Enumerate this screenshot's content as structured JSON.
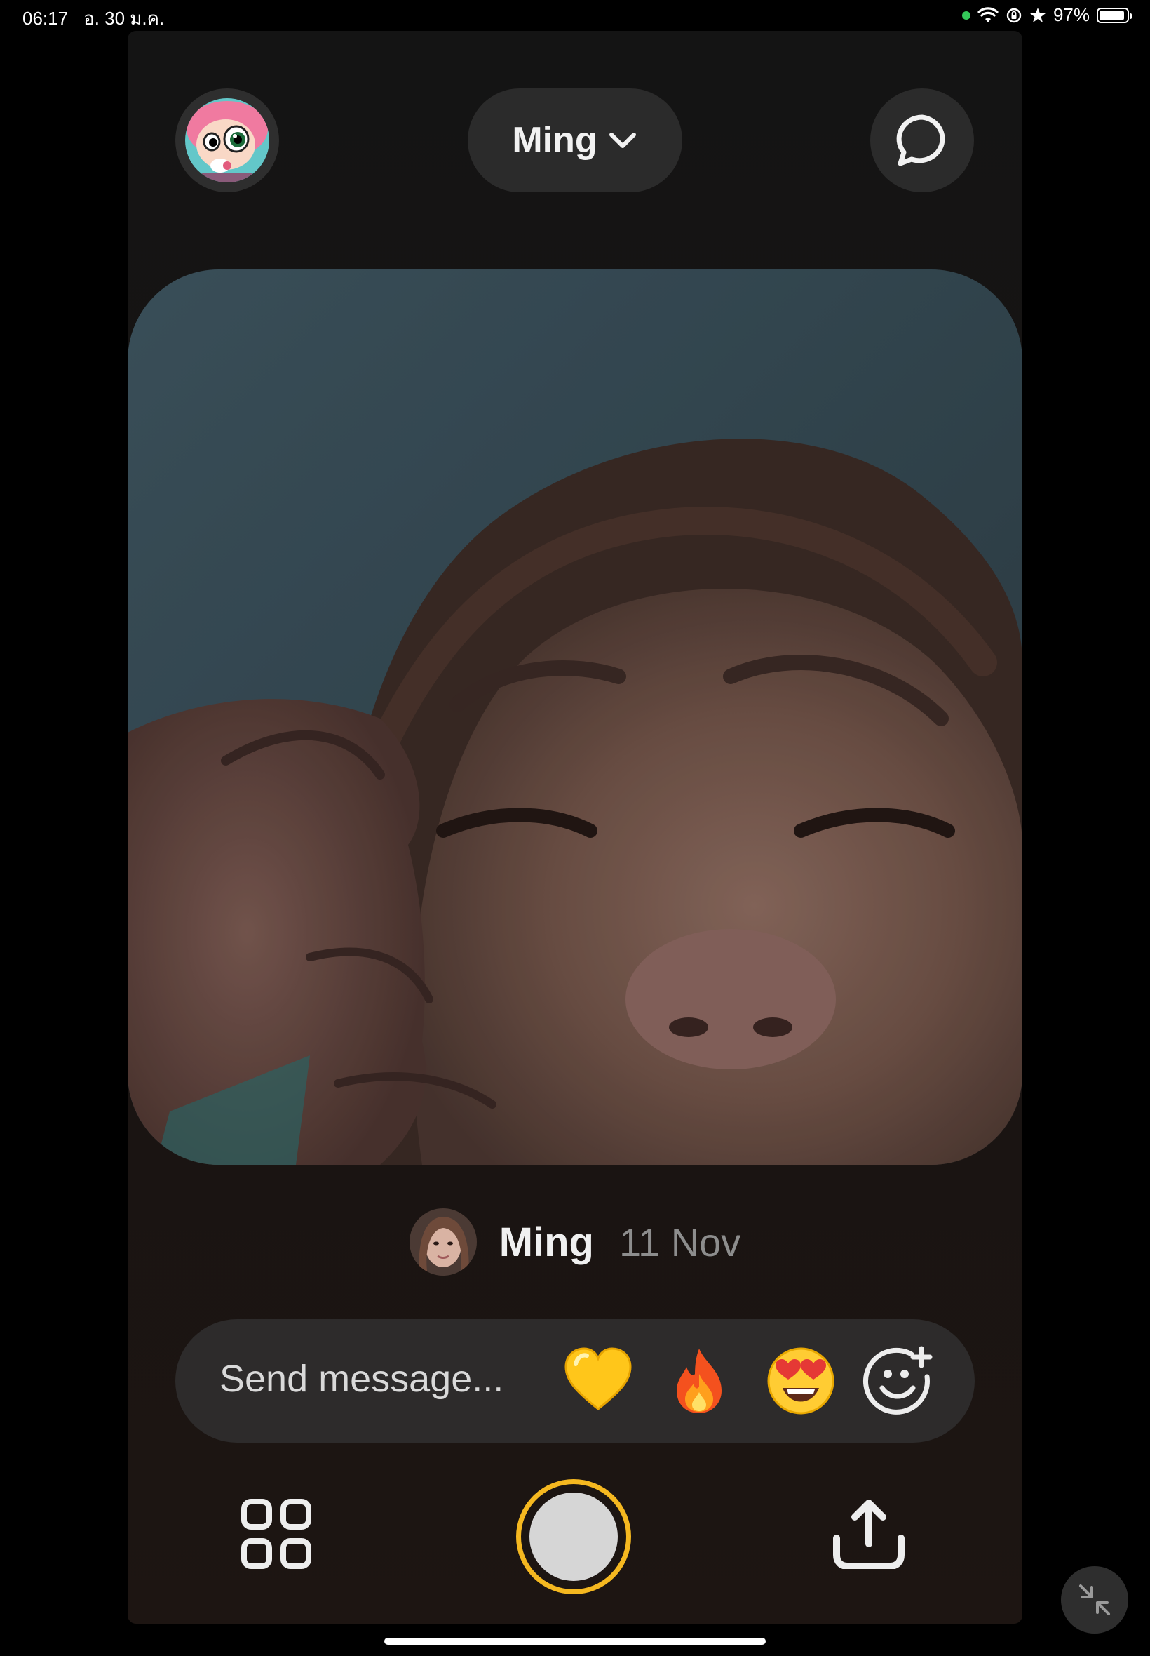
{
  "status_bar": {
    "time": "06:17",
    "date": "อ. 30 ม.ค.",
    "battery": "97%",
    "battery_level": 0.97
  },
  "header": {
    "friend_selector_label": "Ming",
    "icons": [
      "profile-avatar",
      "chevron-down-icon",
      "chat-bubble-icon"
    ]
  },
  "post": {
    "author_name": "Ming",
    "date": "11 Nov"
  },
  "message_bar": {
    "placeholder": "Send message...",
    "reactions": [
      "yellow-heart",
      "fire",
      "heart-eyes",
      "add-reaction"
    ]
  },
  "bottom_bar": {
    "icons": [
      "grid-icon",
      "shutter-button",
      "share-upload-icon"
    ]
  },
  "colors": {
    "shutter_ring": "#f5b820",
    "background": "#000000",
    "panel": "#2b2b2b"
  }
}
